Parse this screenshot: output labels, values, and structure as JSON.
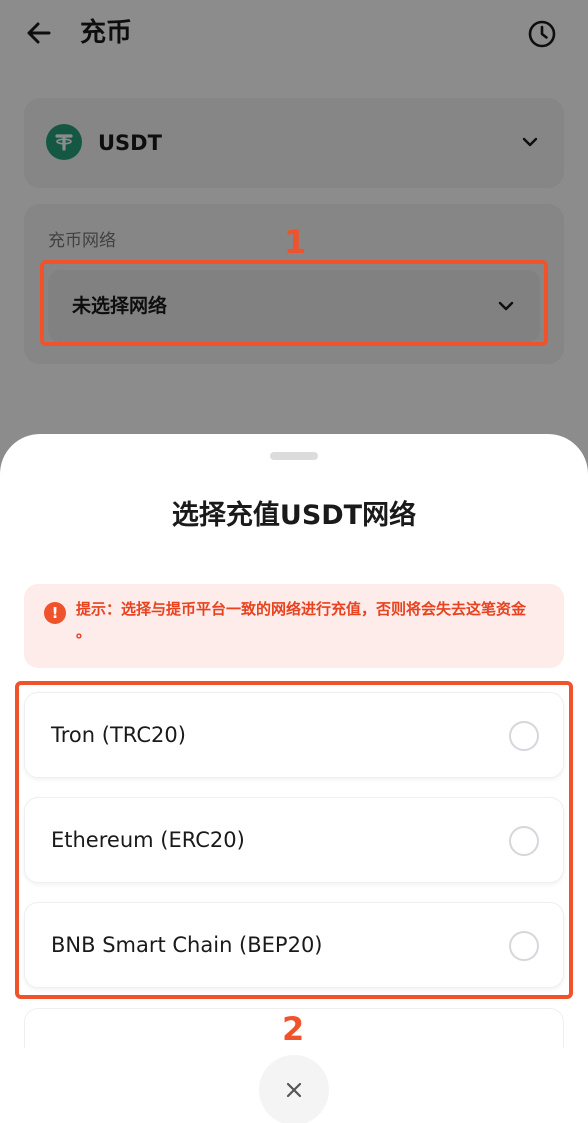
{
  "header": {
    "title": "充币",
    "back_icon": "arrow-left-icon",
    "history_icon": "clock-icon"
  },
  "coin": {
    "name": "USDT",
    "logo_icon": "tether-icon",
    "logo_color": "#26a17b"
  },
  "network": {
    "label": "充币网络",
    "placeholder": "未选择网络"
  },
  "sheet": {
    "title": "选择充值USDT网络",
    "tip": "提示：选择与提币平台一致的网络进行充值，否则将会失去这笔资金 。",
    "options": [
      {
        "label": "Tron (TRC20)",
        "selected": false
      },
      {
        "label": "Ethereum (ERC20)",
        "selected": false
      },
      {
        "label": "BNB Smart Chain (BEP20)",
        "selected": false
      }
    ],
    "close_icon": "close-icon"
  },
  "annotations": {
    "step1": "1",
    "step2": "2",
    "color": "#f0532b"
  },
  "colors": {
    "warning": "#e8421f",
    "warning_bg": "#fdecea"
  }
}
